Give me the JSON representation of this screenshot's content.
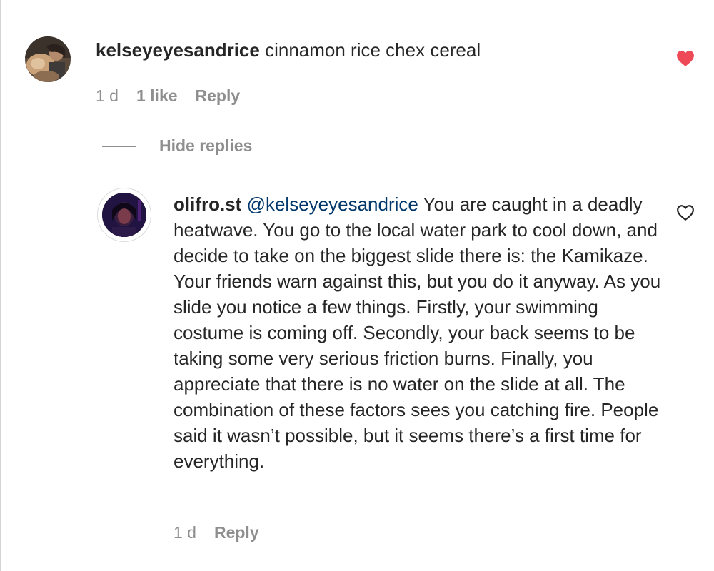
{
  "comment1": {
    "username": "kelseyeyesandrice",
    "text": "cinnamon rice chex cereal",
    "time": "1 d",
    "likes": "1 like",
    "reply_label": "Reply",
    "liked": true
  },
  "replies_toggle": {
    "label": "Hide replies"
  },
  "comment2": {
    "username": "olifro.st",
    "mention": "@kelseyeyesandrice",
    "text": "You are caught in a deadly heatwave. You go to the local water park to cool down, and decide to take on the biggest slide there is: the Kamikaze. Your friends warn against this, but you do it anyway. As you slide you notice a few things. Firstly, your swimming costume is coming off. Secondly, your back seems to be taking some very serious friction burns. Finally, you appreciate that there is no water on the slide at all. The combination of these factors sees you catching fire. People said it wasn’t possible, but it seems there’s a first time for everything.",
    "time": "1 d",
    "reply_label": "Reply",
    "liked": false
  },
  "colors": {
    "text": "#262626",
    "muted": "#8e8e8e",
    "mention": "#00376b",
    "like_red": "#ed4956"
  },
  "icons": {
    "heart_filled": "heart-filled-icon",
    "heart_outline": "heart-outline-icon"
  }
}
